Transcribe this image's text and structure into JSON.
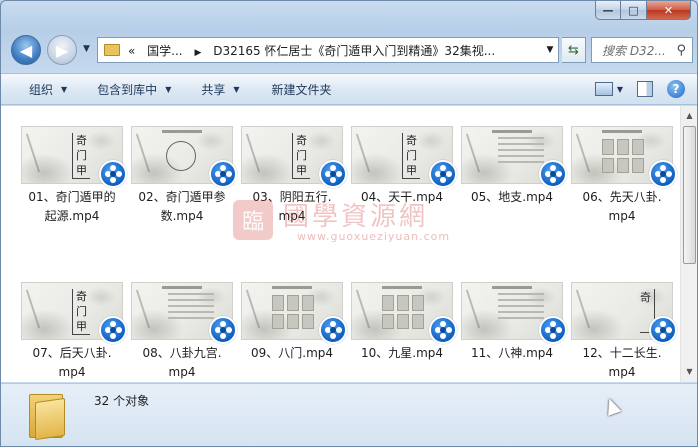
{
  "window": {
    "controls": {
      "minimize": "—",
      "maximize": "□",
      "close": "✕"
    }
  },
  "address": {
    "crumbs": [
      "«",
      "国学...",
      "D32165 怀仁居士《奇门遁甲入门到精通》32集视..."
    ],
    "search_placeholder": "搜索 D32..."
  },
  "toolbar": {
    "items": [
      "组织",
      "包含到库中",
      "共享",
      "新建文件夹"
    ]
  },
  "files": [
    {
      "name": "01、奇门遁甲的起源.mp4",
      "line1": "01、奇门遁甲的",
      "line2": "起源.mp4",
      "thumb": "char",
      "text": "奇门甲"
    },
    {
      "name": "02、奇门遁甲参数.mp4",
      "line1": "02、奇门遁甲参",
      "line2": "数.mp4",
      "thumb": "circle",
      "text": ""
    },
    {
      "name": "03、阴阳五行.mp4",
      "line1": "03、阴阳五行.",
      "line2": "mp4",
      "thumb": "char",
      "text": "奇门甲"
    },
    {
      "name": "04、天干.mp4",
      "line1": "04、天干.mp4",
      "line2": "",
      "thumb": "char",
      "text": "奇门甲"
    },
    {
      "name": "05、地支.mp4",
      "line1": "05、地支.mp4",
      "line2": "",
      "thumb": "lines",
      "text": ""
    },
    {
      "name": "06、先天八卦.mp4",
      "line1": "06、先天八卦.",
      "line2": "mp4",
      "thumb": "grid",
      "text": ""
    },
    {
      "name": "07、后天八卦.mp4",
      "line1": "07、后天八卦.",
      "line2": "mp4",
      "thumb": "char",
      "text": "奇门甲"
    },
    {
      "name": "08、八卦九宫.mp4",
      "line1": "08、八卦九宫.",
      "line2": "mp4",
      "thumb": "lines",
      "text": ""
    },
    {
      "name": "09、八门.mp4",
      "line1": "09、八门.mp4",
      "line2": "",
      "thumb": "grid",
      "text": ""
    },
    {
      "name": "10、九星.mp4",
      "line1": "10、九星.mp4",
      "line2": "",
      "thumb": "grid",
      "text": ""
    },
    {
      "name": "11、八神.mp4",
      "line1": "11、八神.mp4",
      "line2": "",
      "thumb": "lines",
      "text": ""
    },
    {
      "name": "12、十二长生.mp4",
      "line1": "12、十二长生.",
      "line2": "mp4",
      "thumb": "vert",
      "text": "奇"
    }
  ],
  "watermark": {
    "seal": "臨",
    "title": "國學資源網",
    "url": "www.guoxueziyuan.com"
  },
  "status": {
    "count": "32 个对象"
  }
}
